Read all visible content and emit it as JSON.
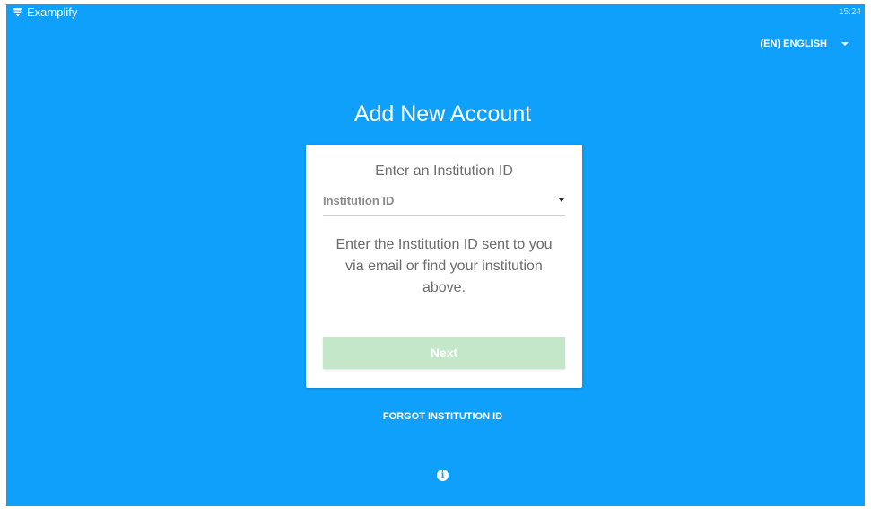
{
  "app": {
    "brand_name": "Examplify",
    "clock": "15:24",
    "brand_icon": "examplify-logo-icon",
    "background_color": "#0fa0fb"
  },
  "language": {
    "label": "(EN) ENGLISH",
    "icon": "caret-down-icon"
  },
  "page": {
    "title": "Add New Account"
  },
  "card": {
    "title": "Enter an Institution ID",
    "select": {
      "placeholder": "Institution ID",
      "icon": "dropdown-arrow-icon"
    },
    "help_text": "Enter the Institution ID sent to you via email or find your institution above.",
    "next_button": {
      "label": "Next",
      "color": "#c5e7c9"
    }
  },
  "footer": {
    "forgot_link": "FORGOT INSTITUTION ID",
    "info_icon": "info-icon",
    "info_glyph": "i"
  }
}
